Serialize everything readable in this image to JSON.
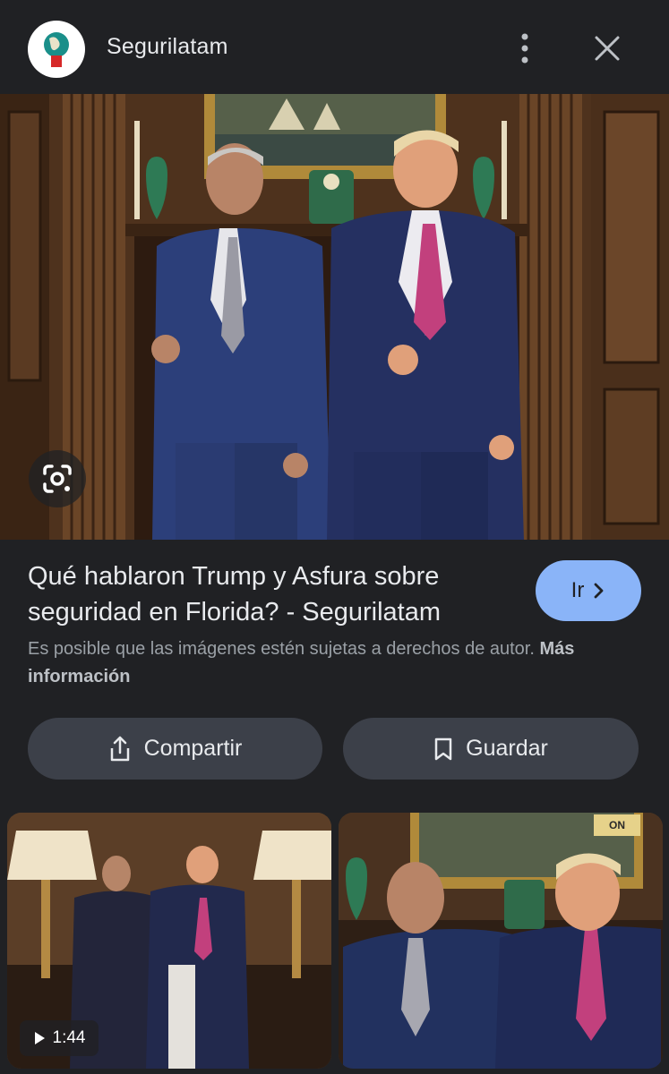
{
  "header": {
    "site_name": "Segurilatam",
    "site_icon": "globe-logo-icon",
    "more_icon": "more-vert-icon",
    "close_icon": "close-icon"
  },
  "hero": {
    "image": "photo of two men in suits giving thumbs up in wood-paneled room",
    "lens_icon": "google-lens-icon"
  },
  "result": {
    "title": "Qué hablaron Trump y Asfura sobre seguridad en Florida? - Segurilatam",
    "go_label": "Ir",
    "copyright_text": "Es posible que las imágenes estén sujetas a derechos de autor.",
    "more_info_label": "Más información"
  },
  "actions": {
    "share_label": "Compartir",
    "save_label": "Guardar"
  },
  "related": [
    {
      "duration": "1:44",
      "is_video": true
    },
    {
      "badge": "ON"
    }
  ],
  "colors": {
    "background": "#202124",
    "button_bg": "#3c4049",
    "accent": "#8ab4f8"
  }
}
